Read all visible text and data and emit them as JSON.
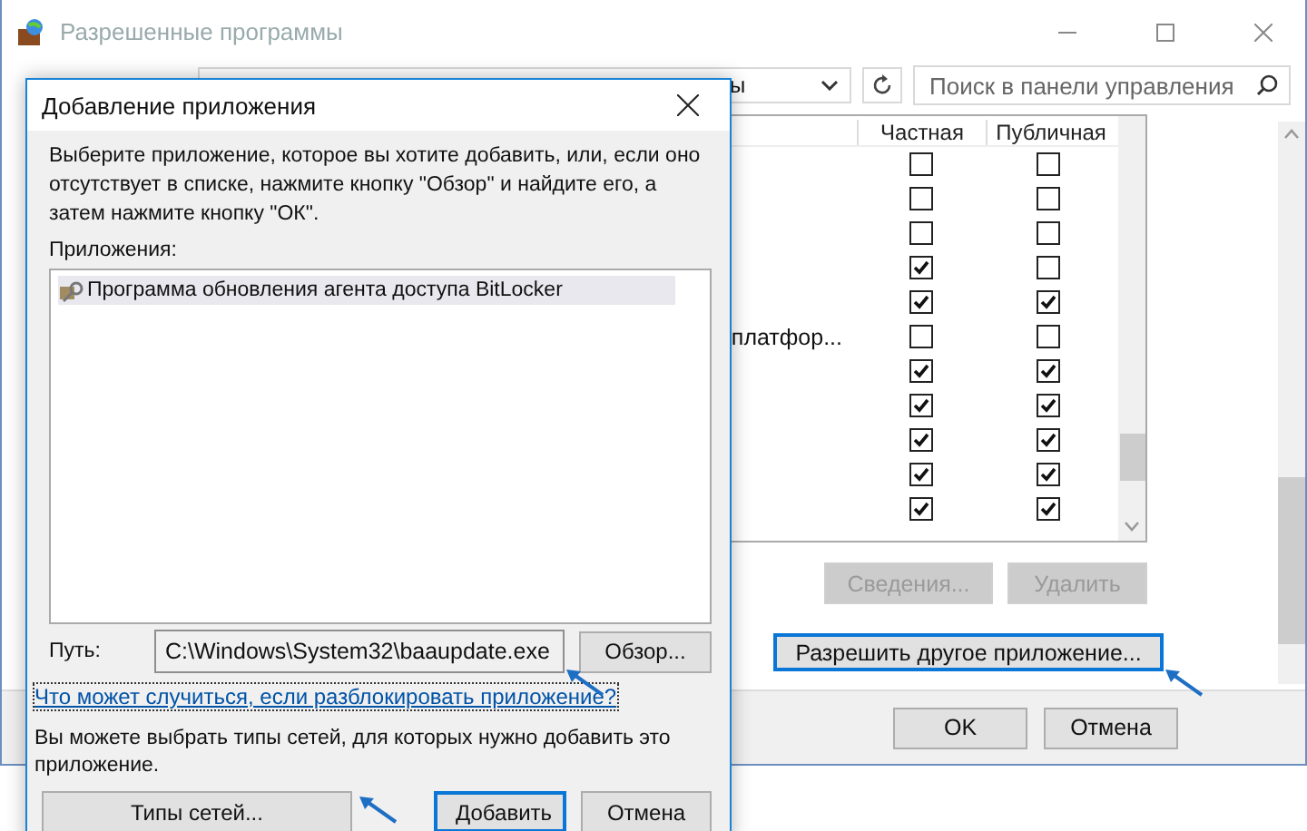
{
  "window": {
    "title": "Разрешенные программы"
  },
  "address_bar": {
    "value": "ы"
  },
  "search": {
    "placeholder": "Поиск в панели управления"
  },
  "table": {
    "columns": [
      "Частная",
      "Публичная"
    ],
    "rows": [
      {
        "private": false,
        "public": false
      },
      {
        "private": false,
        "public": false
      },
      {
        "private": false,
        "public": false
      },
      {
        "private": true,
        "public": false
      },
      {
        "private": true,
        "public": true
      },
      {
        "name": "платфор...",
        "private": false,
        "public": false
      },
      {
        "private": true,
        "public": true
      },
      {
        "private": true,
        "public": true
      },
      {
        "private": true,
        "public": true
      },
      {
        "private": true,
        "public": true
      },
      {
        "private": true,
        "public": true
      }
    ]
  },
  "list_buttons": [
    {
      "label": "Сведения...",
      "disabled": true
    },
    {
      "label": "Удалить",
      "disabled": true
    }
  ],
  "allow_button": {
    "label": "Разрешить другое приложение...",
    "focused": true
  },
  "footer_buttons": [
    {
      "label": "OK"
    },
    {
      "label": "Отмена"
    }
  ],
  "dialog": {
    "title": "Добавление приложения",
    "instructions": "Выберите приложение, которое вы хотите добавить, или, если оно отсутствует в списке, нажмите кнопку \"Обзор\" и найдите его, а затем нажмите кнопку \"ОК\".",
    "apps_label": "Приложения:",
    "apps": [
      {
        "label": "Программа обновления агента доступа BitLocker",
        "selected": true
      }
    ],
    "path_label": "Путь:",
    "path_value": "C:\\Windows\\System32\\baaupdate.exe",
    "browse_button": "Обзор...",
    "link": "Что может случиться, если разблокировать приложение?",
    "network_note": "Вы можете выбрать типы сетей, для которых нужно добавить это приложение.",
    "buttons": [
      {
        "label": "Типы сетей...",
        "focused": false
      },
      {
        "label": "Добавить",
        "focused": true
      },
      {
        "label": "Отмена",
        "focused": false
      }
    ]
  }
}
